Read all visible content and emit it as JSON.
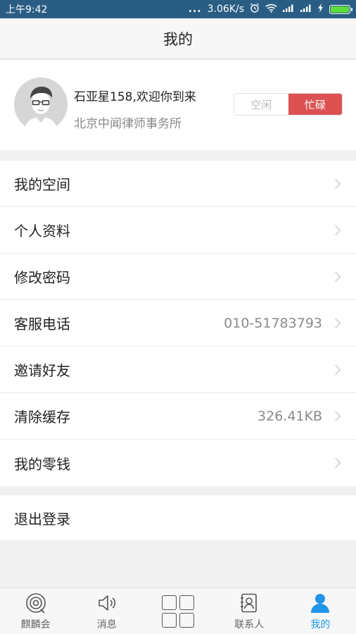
{
  "status_bar": {
    "time": "上午9:42",
    "signal_dots": "...",
    "net_speed": "3.06K/s",
    "battery_level": 1.0,
    "battery_color": "#5bdc3c"
  },
  "header": {
    "title": "我的"
  },
  "profile": {
    "name": "石亚星158,欢迎你到来",
    "organization": "北京中闻律师事务所",
    "status_idle": "空闲",
    "status_busy": "忙碌",
    "selected_status": "忙碌",
    "busy_color": "#dc5152"
  },
  "menu": {
    "items": [
      {
        "label": "我的空间",
        "value": ""
      },
      {
        "label": "个人资料",
        "value": ""
      },
      {
        "label": "修改密码",
        "value": ""
      },
      {
        "label": "客服电话",
        "value": "010-51783793"
      },
      {
        "label": "邀请好友",
        "value": ""
      },
      {
        "label": "清除缓存",
        "value": "326.41KB"
      },
      {
        "label": "我的零钱",
        "value": ""
      }
    ]
  },
  "logout": {
    "label": "退出登录"
  },
  "tabbar": {
    "active_color": "#2196e8",
    "tabs": [
      {
        "label": "麒麟会",
        "icon": "qilin-icon"
      },
      {
        "label": "消息",
        "icon": "speaker-icon"
      },
      {
        "label": "",
        "icon": "grid-icon"
      },
      {
        "label": "联系人",
        "icon": "contacts-icon"
      },
      {
        "label": "我的",
        "icon": "person-icon"
      }
    ],
    "active_index": 4
  }
}
